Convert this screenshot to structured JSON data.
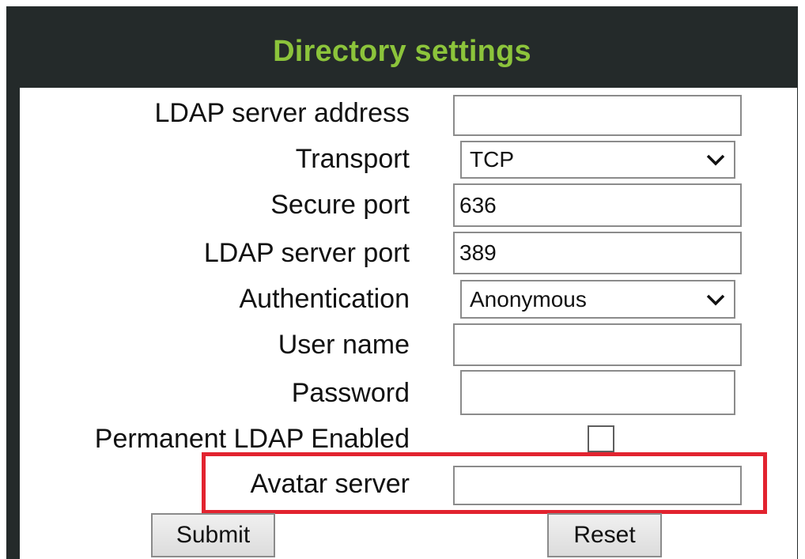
{
  "title": "Directory settings",
  "fields": {
    "ldap_server_address": {
      "label": "LDAP server address",
      "value": ""
    },
    "transport": {
      "label": "Transport",
      "value": "TCP"
    },
    "secure_port": {
      "label": "Secure port",
      "value": "636"
    },
    "ldap_server_port": {
      "label": "LDAP server port",
      "value": "389"
    },
    "authentication": {
      "label": "Authentication",
      "value": "Anonymous"
    },
    "user_name": {
      "label": "User name",
      "value": ""
    },
    "password": {
      "label": "Password",
      "value": ""
    },
    "permanent_ldap": {
      "label": "Permanent LDAP Enabled",
      "checked": false
    },
    "avatar_server": {
      "label": "Avatar server",
      "value": ""
    }
  },
  "buttons": {
    "submit": "Submit",
    "reset": "Reset"
  },
  "colors": {
    "header_bg": "#242a2a",
    "title": "#8cc43b",
    "highlight": "#e2232f"
  },
  "icons": {
    "dropdown": "chevron-down-icon"
  }
}
